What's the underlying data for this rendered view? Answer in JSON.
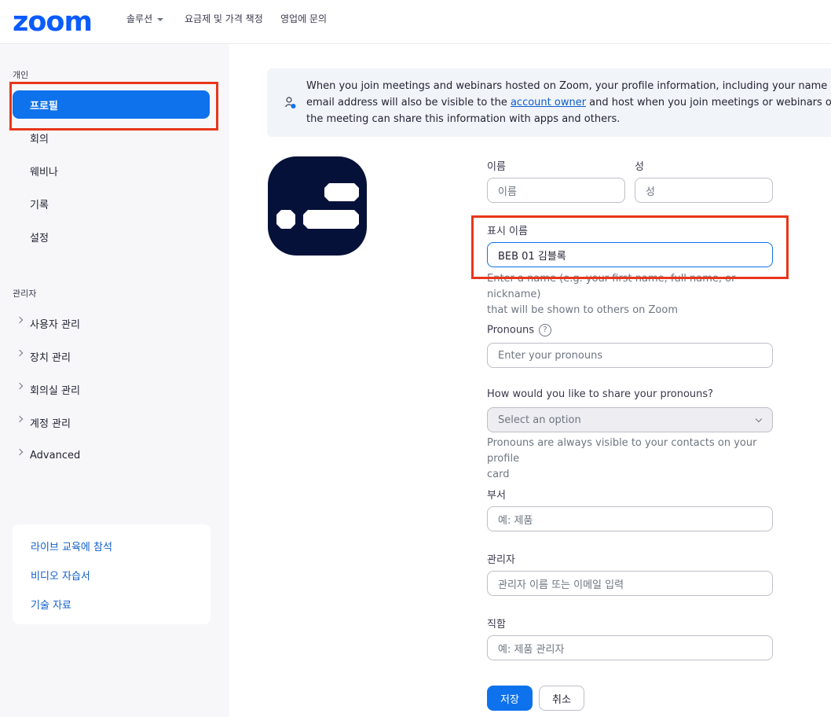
{
  "header": {
    "logo": "zoom",
    "nav": [
      "솔루션",
      "요금제 및 가격 책정",
      "영업에 문의"
    ]
  },
  "sidebar": {
    "section_personal": "개인",
    "personal_items": [
      "프로필",
      "회의",
      "웨비나",
      "기록",
      "설정"
    ],
    "section_admin": "관리자",
    "admin_items": [
      "사용자 관리",
      "장치 관리",
      "회의실 관리",
      "계정 관리",
      "Advanced"
    ],
    "resources": [
      "라이브 교육에 참석",
      "비디오 자습서",
      "기술 자료"
    ]
  },
  "notice": {
    "line1": "When you join meetings and webinars hosted on Zoom, your profile information, including your name and profile picture, may be visible to other participants. Your name and",
    "line2_before": "email address will also be visible to the ",
    "link": "account owner",
    "line2_after": " and host when you join meetings or webinars on their account while you're signed in. The account owner and others in",
    "line3": "the meeting can share this information with apps and others."
  },
  "form": {
    "first_name_label": "이름",
    "first_name_placeholder": "이름",
    "last_name_label": "성",
    "last_name_placeholder": "성",
    "display_name_label": "표시 이름",
    "display_name_value": "BEB 01 김블록",
    "display_name_help_1": "Enter a name (e.g. your first name, full name, or nickname)",
    "display_name_help_2": "that will be shown to others on Zoom",
    "pronouns_label": "Pronouns",
    "pronouns_placeholder": "Enter your pronouns",
    "share_label": "How would you like to share your pronouns?",
    "share_value": "Select an option",
    "share_help_1": "Pronouns are always visible to your contacts on your profile",
    "share_help_2": "card",
    "department_label": "부서",
    "department_placeholder": "예: 제품",
    "manager_label": "관리자",
    "manager_placeholder": "관리자 이름 또는 이메일 입력",
    "title_label": "직함",
    "title_placeholder": "예: 제품 관리자",
    "save": "저장",
    "cancel": "취소"
  },
  "colors": {
    "brand": "#0b5cff",
    "accent": "#0e72ed",
    "highlight": "#e8361b",
    "avatar_bg": "#051139"
  },
  "icons": [
    "user-info-icon",
    "question-icon",
    "chevron-down-icon",
    "chevron-right-icon"
  ]
}
